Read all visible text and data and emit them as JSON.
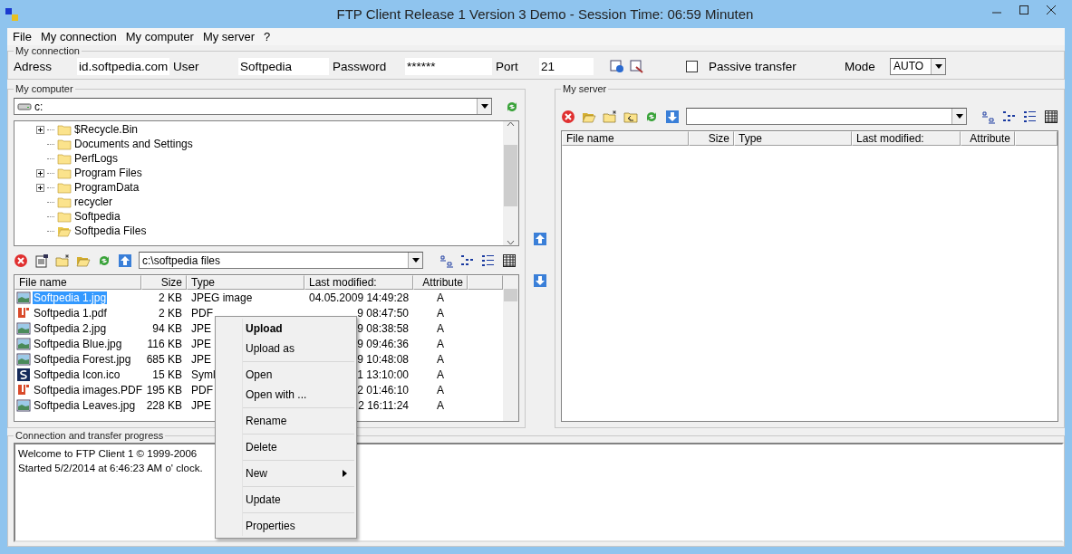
{
  "window": {
    "title": "FTP Client Release 1 Version 3 Demo - Session Time: 06:59 Minuten"
  },
  "menu": [
    "File",
    "My connection",
    "My computer",
    "My server",
    "?"
  ],
  "connection": {
    "title": "My connection",
    "address_label": "Adress",
    "address": "id.softpedia.com",
    "user_label": "User",
    "user": "Softpedia",
    "password_label": "Password",
    "password": "******",
    "port_label": "Port",
    "port": "21",
    "passive": {
      "label": "Passive transfer",
      "checked": false
    },
    "mode_label": "Mode",
    "mode": "AUTO"
  },
  "computer": {
    "title": "My computer",
    "drive": "c:",
    "tree": [
      {
        "label": "$Recycle.Bin",
        "expandable": true,
        "open": false
      },
      {
        "label": "Documents and Settings",
        "expandable": false,
        "open": false
      },
      {
        "label": "PerfLogs",
        "expandable": false,
        "open": false
      },
      {
        "label": "Program Files",
        "expandable": true,
        "open": false
      },
      {
        "label": "ProgramData",
        "expandable": true,
        "open": false
      },
      {
        "label": "recycler",
        "expandable": false,
        "open": false
      },
      {
        "label": "Softpedia",
        "expandable": false,
        "open": false
      },
      {
        "label": "Softpedia Files",
        "expandable": false,
        "open": true
      }
    ],
    "path": "c:\\softpedia files",
    "columns": [
      "File name",
      "Size",
      "Type",
      "Last modified:",
      "Attribute"
    ],
    "files": [
      {
        "name": "Softpedia 1.jpg",
        "kind": "image",
        "size": "2 KB",
        "type": "JPEG image",
        "modified": "04.05.2009 14:49:28",
        "attribute": "A",
        "selected": true
      },
      {
        "name": "Softpedia 1.pdf",
        "kind": "pdf",
        "size": "2 KB",
        "type": "PDF",
        "modified": "9 08:47:50",
        "attribute": "A",
        "selected": false
      },
      {
        "name": "Softpedia 2.jpg",
        "kind": "image",
        "size": "94 KB",
        "type": "JPE",
        "modified": "9 08:38:58",
        "attribute": "A",
        "selected": false
      },
      {
        "name": "Softpedia Blue.jpg",
        "kind": "image",
        "size": "116 KB",
        "type": "JPE",
        "modified": "9 09:46:36",
        "attribute": "A",
        "selected": false
      },
      {
        "name": "Softpedia Forest.jpg",
        "kind": "image",
        "size": "685 KB",
        "type": "JPE",
        "modified": "9 10:48:08",
        "attribute": "A",
        "selected": false
      },
      {
        "name": "Softpedia Icon.ico",
        "kind": "symbol",
        "size": "15 KB",
        "type": "Syml",
        "modified": "1 13:10:00",
        "attribute": "A",
        "selected": false
      },
      {
        "name": "Softpedia images.PDF",
        "kind": "pdf",
        "size": "195 KB",
        "type": "PDF",
        "modified": "2 01:46:10",
        "attribute": "A",
        "selected": false
      },
      {
        "name": "Softpedia Leaves.jpg",
        "kind": "image",
        "size": "228 KB",
        "type": "JPE",
        "modified": "2 16:11:24",
        "attribute": "A",
        "selected": false
      }
    ]
  },
  "server": {
    "title": "My server",
    "columns": [
      "File name",
      "Size",
      "Type",
      "Last modified:",
      "Attribute"
    ]
  },
  "progress": {
    "title": "Connection and transfer progress",
    "lines": [
      "Welcome to FTP Client 1 © 1999-2006",
      "Started 5/2/2014 at 6:46:23 AM o' clock."
    ]
  },
  "context_menu": [
    {
      "label": "Upload",
      "bold": true,
      "separator_before": false,
      "submenu": false
    },
    {
      "label": "Upload as",
      "bold": false,
      "separator_before": false,
      "submenu": false
    },
    {
      "label": "Open",
      "bold": false,
      "separator_before": true,
      "submenu": false
    },
    {
      "label": "Open with ...",
      "bold": false,
      "separator_before": false,
      "submenu": false
    },
    {
      "label": "Rename",
      "bold": false,
      "separator_before": true,
      "submenu": false
    },
    {
      "label": "Delete",
      "bold": false,
      "separator_before": true,
      "submenu": false
    },
    {
      "label": "New",
      "bold": false,
      "separator_before": true,
      "submenu": true
    },
    {
      "label": "Update",
      "bold": false,
      "separator_before": true,
      "submenu": false
    },
    {
      "label": "Properties",
      "bold": false,
      "separator_before": true,
      "submenu": false
    }
  ]
}
